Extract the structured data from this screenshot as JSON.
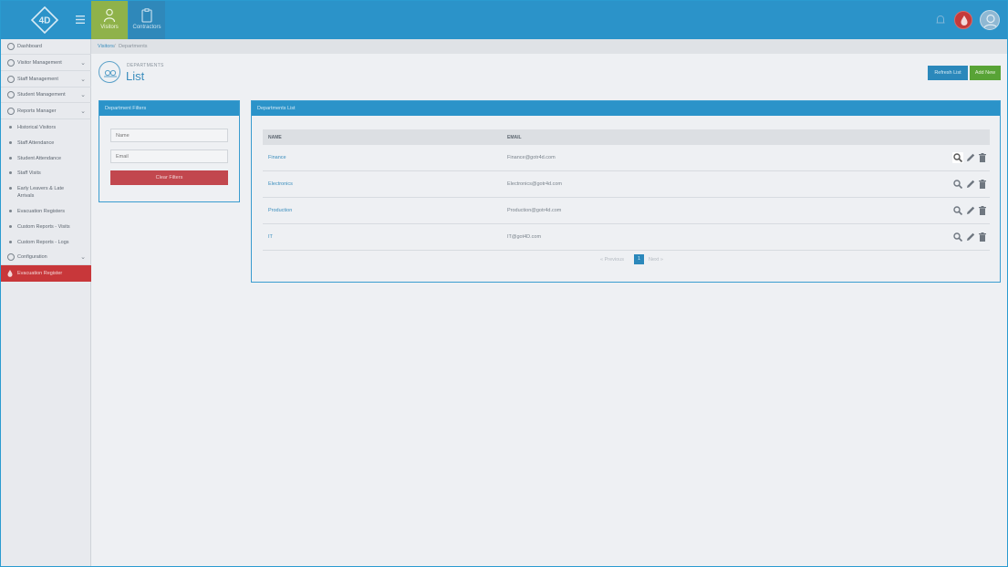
{
  "topbar": {
    "logo_text": "4D",
    "tabs": [
      {
        "label": "Visitors",
        "icon": "person-icon"
      },
      {
        "label": "Contractors",
        "icon": "clipboard-icon"
      }
    ],
    "icons": [
      "bell-icon",
      "blood-drop-icon",
      "user-avatar-icon"
    ]
  },
  "sidebar": {
    "items": [
      {
        "label": "Dashboard",
        "icon": "dashboard-icon"
      },
      {
        "label": "Visitor Management",
        "icon": "person-icon"
      },
      {
        "label": "Staff Management",
        "icon": "id-card-icon"
      },
      {
        "label": "Student Management",
        "icon": "student-icon"
      },
      {
        "label": "Reports Manager",
        "icon": "reports-icon"
      }
    ],
    "subitems": [
      {
        "label": "Historical Visitors"
      },
      {
        "label": "Staff Attendance"
      },
      {
        "label": "Student Attendance"
      },
      {
        "label": "Staff Visits"
      },
      {
        "label": "Early Leavers & Late Arrivals"
      },
      {
        "label": "Evacuation Registers"
      },
      {
        "label": "Custom Reports - Visits"
      },
      {
        "label": "Custom Reports - Logs"
      }
    ],
    "configuration": {
      "label": "Configuration"
    },
    "evacuation": {
      "label": "Evacuation Register"
    }
  },
  "breadcrumb": {
    "root": "Visitors",
    "separator": "/",
    "current": "Departments"
  },
  "page": {
    "subtitle": "DEPARTMENTS",
    "title": "List"
  },
  "actions": {
    "refresh": "Refresh List",
    "add": "Add New"
  },
  "filters": {
    "title": "Department Filters",
    "name_placeholder": "Name",
    "email_placeholder": "Email",
    "clear": "Clear Filters"
  },
  "list": {
    "title": "Departments List",
    "columns": [
      "NAME",
      "EMAIL"
    ],
    "rows": [
      {
        "name": "Finance",
        "email": "Finance@gotr4d.com"
      },
      {
        "name": "Electronics",
        "email": "Electronics@gotr4d.com"
      },
      {
        "name": "Production",
        "email": "Production@gotr4d.com"
      },
      {
        "name": "IT",
        "email": "IT@got4D.com"
      }
    ],
    "pager": {
      "previous": "«  Previous",
      "page": "1",
      "next": "Next  »"
    }
  },
  "colors": {
    "brand": "#2b93c9",
    "add": "#58a336",
    "danger": "#c2474e",
    "evac": "#c8373a"
  }
}
